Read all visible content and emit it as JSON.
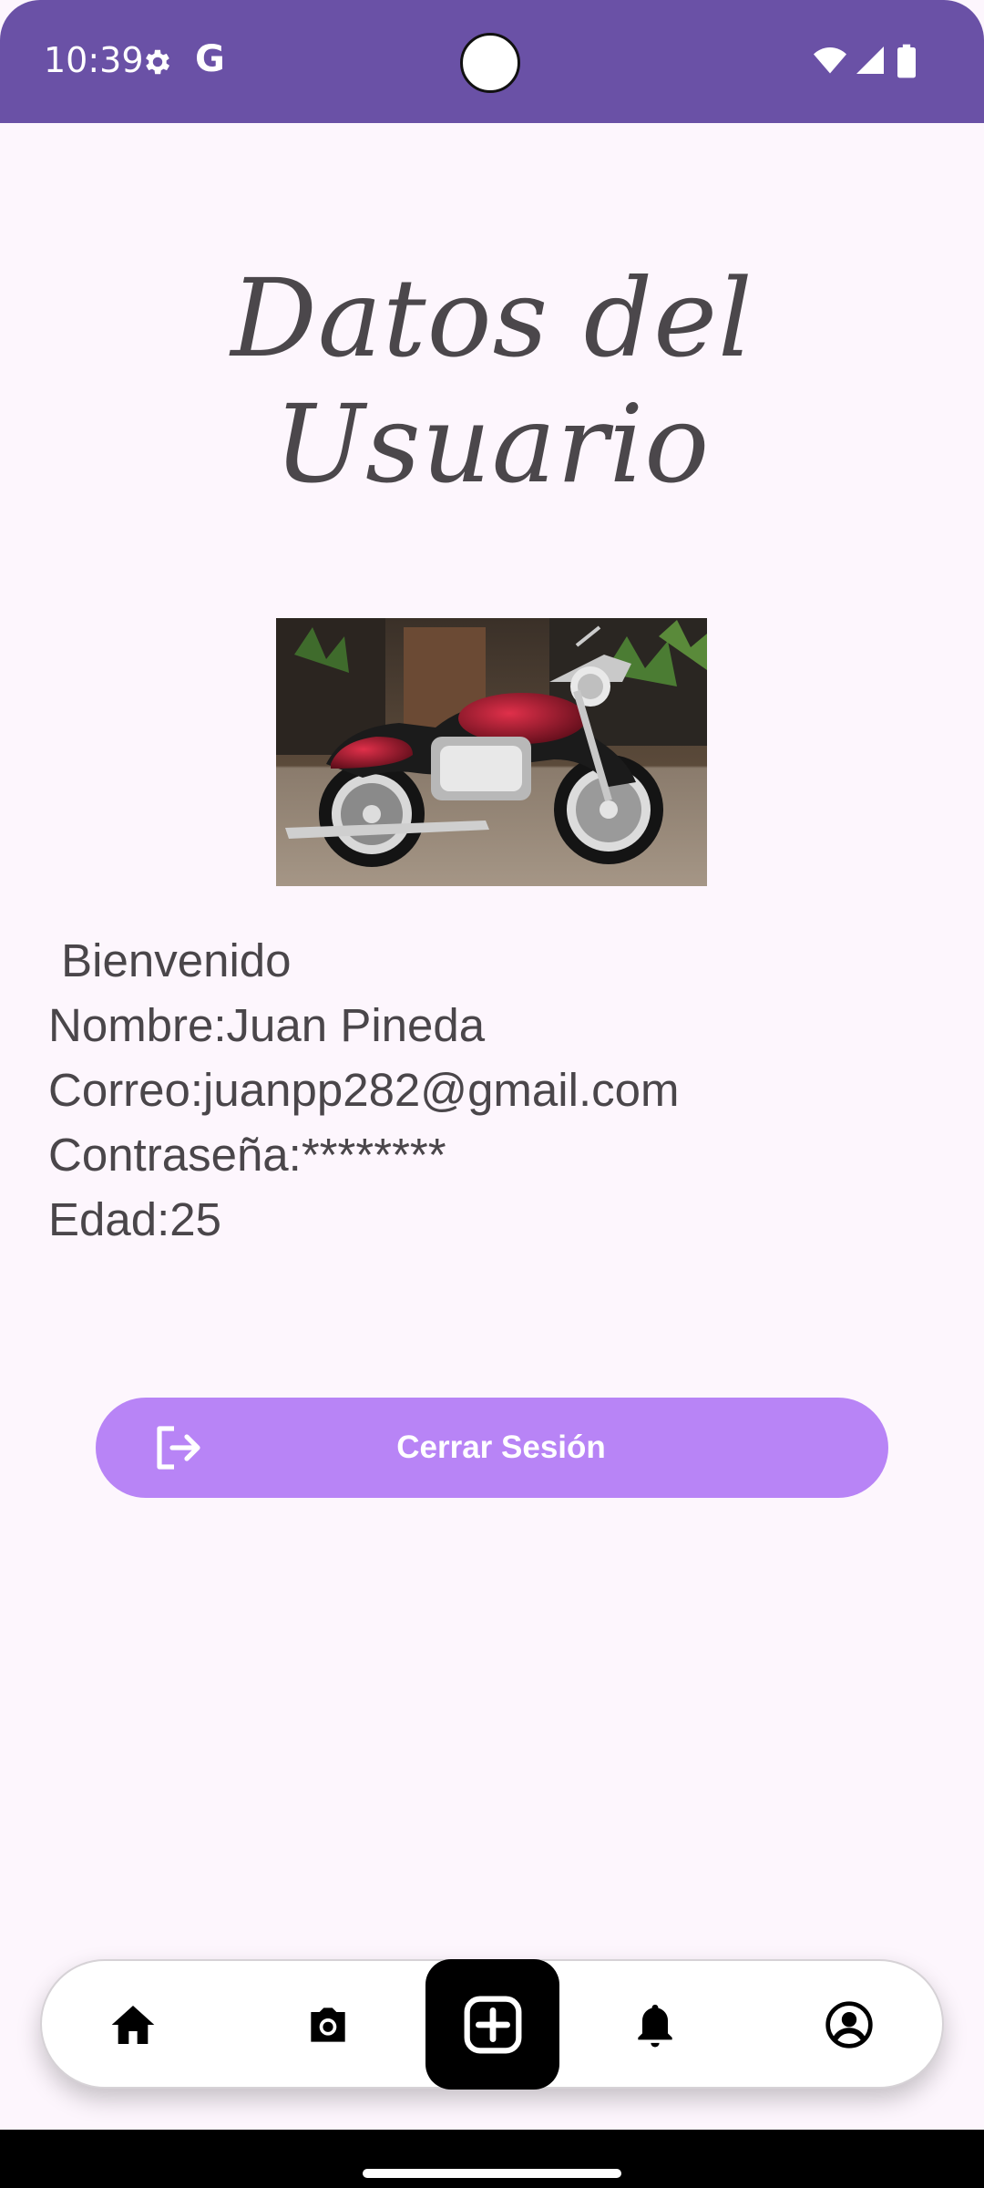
{
  "status_bar": {
    "time": "10:39",
    "icons": [
      "gear-icon",
      "google-g-icon",
      "wifi-icon",
      "signal-icon",
      "battery-icon"
    ],
    "g_label": "G"
  },
  "page": {
    "title": "Datos del Usuario",
    "image_alt": "motorcycle photo"
  },
  "user_info": {
    "welcome": " Bienvenido",
    "name": "Nombre:Juan Pineda",
    "email": "Correo:juanpp282@gmail.com",
    "password": "Contraseña:********",
    "age": "Edad:25"
  },
  "logout": {
    "label": "Cerrar Sesión",
    "icon": "logout-icon"
  },
  "bottom_nav": {
    "items": [
      "home-icon",
      "camera-icon",
      "add-icon",
      "notifications-icon",
      "profile-icon"
    ]
  },
  "colors": {
    "status_bar": "#6a51a6",
    "background": "#fdf6fd",
    "button": "#b884f6",
    "text": "#4a464a"
  }
}
